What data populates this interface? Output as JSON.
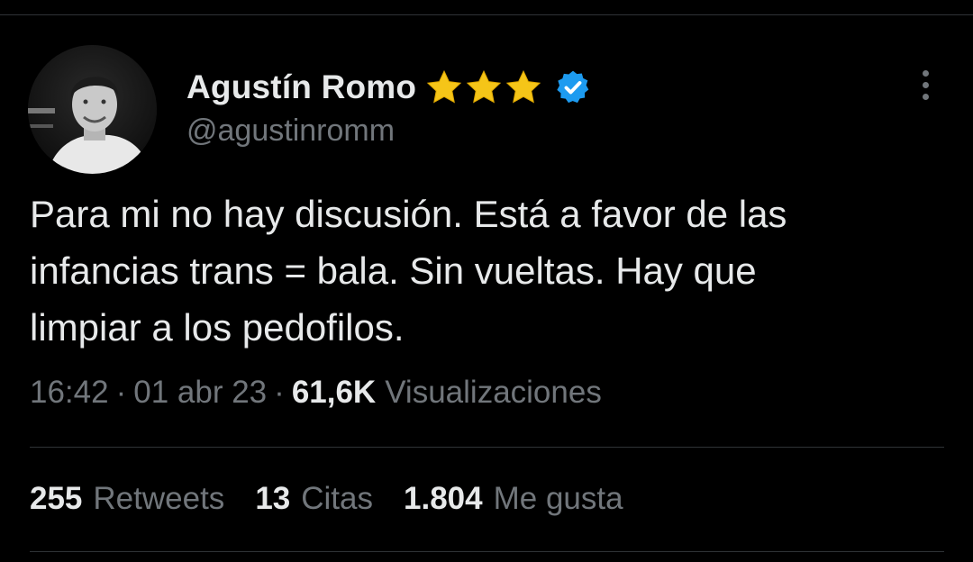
{
  "tweet": {
    "author": {
      "display_name": "Agustín Romo",
      "handle": "@agustinromm",
      "badge_stars": 3,
      "verified": true,
      "star_icon": "star-icon",
      "verified_icon": "verified-badge-icon",
      "avatar_icon": "avatar"
    },
    "text_lines": [
      "Para mi no hay discusión. Está a favor de las",
      "infancias trans = bala. Sin vueltas. Hay que",
      "limpiar a los pedofilos."
    ],
    "meta": {
      "time": "16:42",
      "separator": "·",
      "date": "01 abr 23",
      "views_count": "61,6K",
      "views_label": "Visualizaciones"
    },
    "stats": {
      "retweets_count": "255",
      "retweets_label": "Retweets",
      "quotes_count": "13",
      "quotes_label": "Citas",
      "likes_count": "1.804",
      "likes_label": "Me gusta"
    }
  },
  "colors": {
    "background": "#000000",
    "primary_text": "#e7e9ea",
    "secondary_text": "#71767b",
    "divider": "#2f3336",
    "verified_blue": "#1d9bf0",
    "star_gold": "#f5c518"
  },
  "icons": {
    "more": "more-options-icon"
  }
}
